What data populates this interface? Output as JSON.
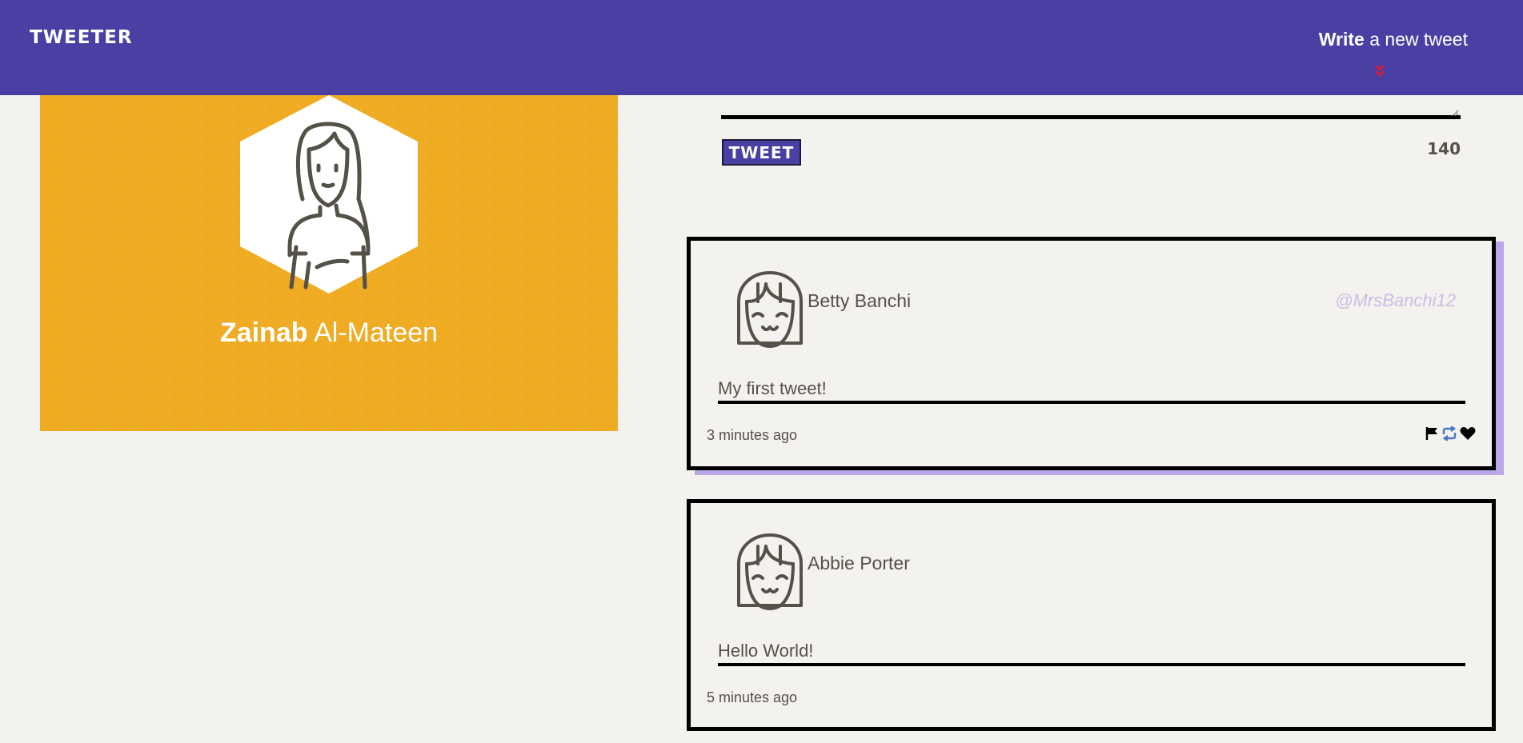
{
  "nav": {
    "brand": "TWEETER",
    "compose_bold": "Write",
    "compose_rest": " a new tweet"
  },
  "profile": {
    "first_name": "Zainab",
    "last_name": " Al-Mateen",
    "bg_color": "#efab22"
  },
  "composer": {
    "button_label": "TWEET",
    "counter": "140"
  },
  "tweets": [
    {
      "author": "Betty Banchi",
      "handle": "@MrsBanchi12",
      "content": "My first tweet!",
      "time": "3 minutes ago",
      "icons": [
        "flag-icon",
        "retweet-icon",
        "heart-icon"
      ]
    },
    {
      "author": "Abbie Porter",
      "handle": "",
      "content": "Hello World!",
      "time": "5 minutes ago"
    }
  ],
  "colors": {
    "nav": "#4a40a4",
    "accent_red": "#e01b2c",
    "shadow": "#b9a7e8",
    "handle": "#c9bde6"
  }
}
